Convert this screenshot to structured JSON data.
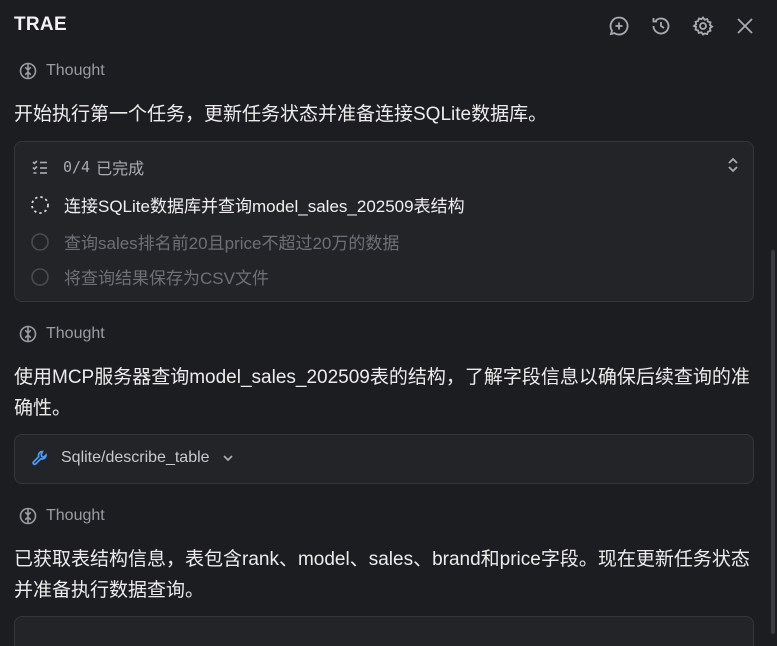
{
  "header": {
    "title": "TRAE",
    "actions": [
      {
        "name": "new-chat-icon"
      },
      {
        "name": "history-icon"
      },
      {
        "name": "gear-icon"
      },
      {
        "name": "close-icon"
      }
    ]
  },
  "thoughts": {
    "t1": "Thought",
    "t2": "Thought",
    "t3": "Thought"
  },
  "messages": {
    "m1": "开始执行第一个任务，更新任务状态并准备连接SQLite数据库。",
    "m2": "使用MCP服务器查询model_sales_202509表的结构，了解字段信息以确保后续查询的准确性。",
    "m3": "已获取表结构信息，表包含rank、model、sales、brand和price字段。现在更新任务状态并准备执行数据查询。"
  },
  "tasks": {
    "progress_count": "0/4",
    "progress_label": "已完成",
    "items": [
      {
        "label": "连接SQLite数据库并查询model_sales_202509表结构",
        "status": "in-progress"
      },
      {
        "label": "查询sales排名前20且price不超过20万的数据",
        "status": "pending"
      },
      {
        "label": "将查询结果保存为CSV文件",
        "status": "pending"
      }
    ]
  },
  "tool_call": {
    "label": "Sqlite/describe_table",
    "icon": "wrench-icon"
  },
  "colors": {
    "background": "#1c1d21",
    "card": "#232428",
    "border": "#34363c",
    "text": "#ececec",
    "muted": "#9b9ca3",
    "tool_icon": "#4a9eff"
  }
}
